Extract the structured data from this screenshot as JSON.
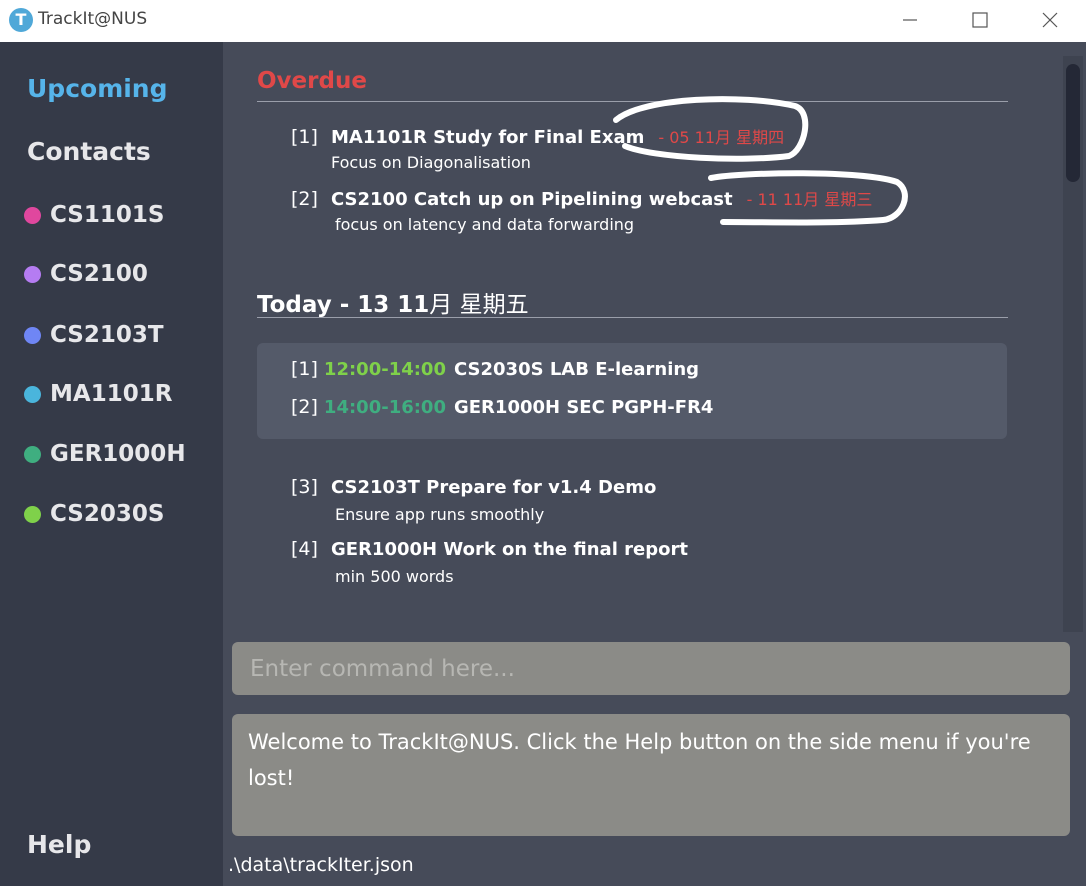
{
  "window": {
    "title": "TrackIt@NUS",
    "icon_letter": "T"
  },
  "sidebar": {
    "upcoming_label": "Upcoming",
    "contacts_label": "Contacts",
    "help_label": "Help",
    "modules": [
      {
        "label": "CS1101S",
        "color": "#e0479e"
      },
      {
        "label": "CS2100",
        "color": "#b57cf2"
      },
      {
        "label": "CS2103T",
        "color": "#6f86f5"
      },
      {
        "label": "MA1101R",
        "color": "#4ab5dc"
      },
      {
        "label": "GER1000H",
        "color": "#3fae80"
      },
      {
        "label": "CS2030S",
        "color": "#7fd14a"
      }
    ],
    "active_color": "#56b4ea"
  },
  "overdue": {
    "title": "Overdue",
    "tasks": [
      {
        "index": "[1]",
        "title": "MA1101R Study for Final Exam",
        "date": "- 05 11月 星期四",
        "description": "Focus on Diagonalisation"
      },
      {
        "index": "[2]",
        "title": "CS2100 Catch up on Pipelining webcast",
        "date": "- 11 11月 星期三",
        "description": "focus on latency and data forwarding"
      }
    ]
  },
  "today": {
    "title_prefix": "Today - 13 11",
    "title_date": "月 星期五",
    "lessons": [
      {
        "index": "[1]",
        "time": "12:00-14:00",
        "time_color": "#7fd14a",
        "text": "CS2030S  LAB  E-learning"
      },
      {
        "index": "[2]",
        "time": "14:00-16:00",
        "time_color": "#3fae80",
        "text": "GER1000H  SEC  PGPH-FR4"
      }
    ],
    "tasks": [
      {
        "index": "[3]",
        "title": "CS2103T Prepare for v1.4 Demo",
        "description": "Ensure app runs smoothly"
      },
      {
        "index": "[4]",
        "title": "GER1000H Work on the final report",
        "description": "min 500 words"
      }
    ]
  },
  "command": {
    "placeholder": "Enter command here...",
    "value": ""
  },
  "result": {
    "text": "Welcome to TrackIt@NUS. Click the Help button on the side menu if you're lost!"
  },
  "status_bar": {
    "path": ".\\data\\trackIter.json"
  },
  "colors": {
    "overdue": "#e04848",
    "sidebar_bg": "#353a48",
    "main_bg": "#464b59",
    "input_bg": "#8b8b87"
  }
}
